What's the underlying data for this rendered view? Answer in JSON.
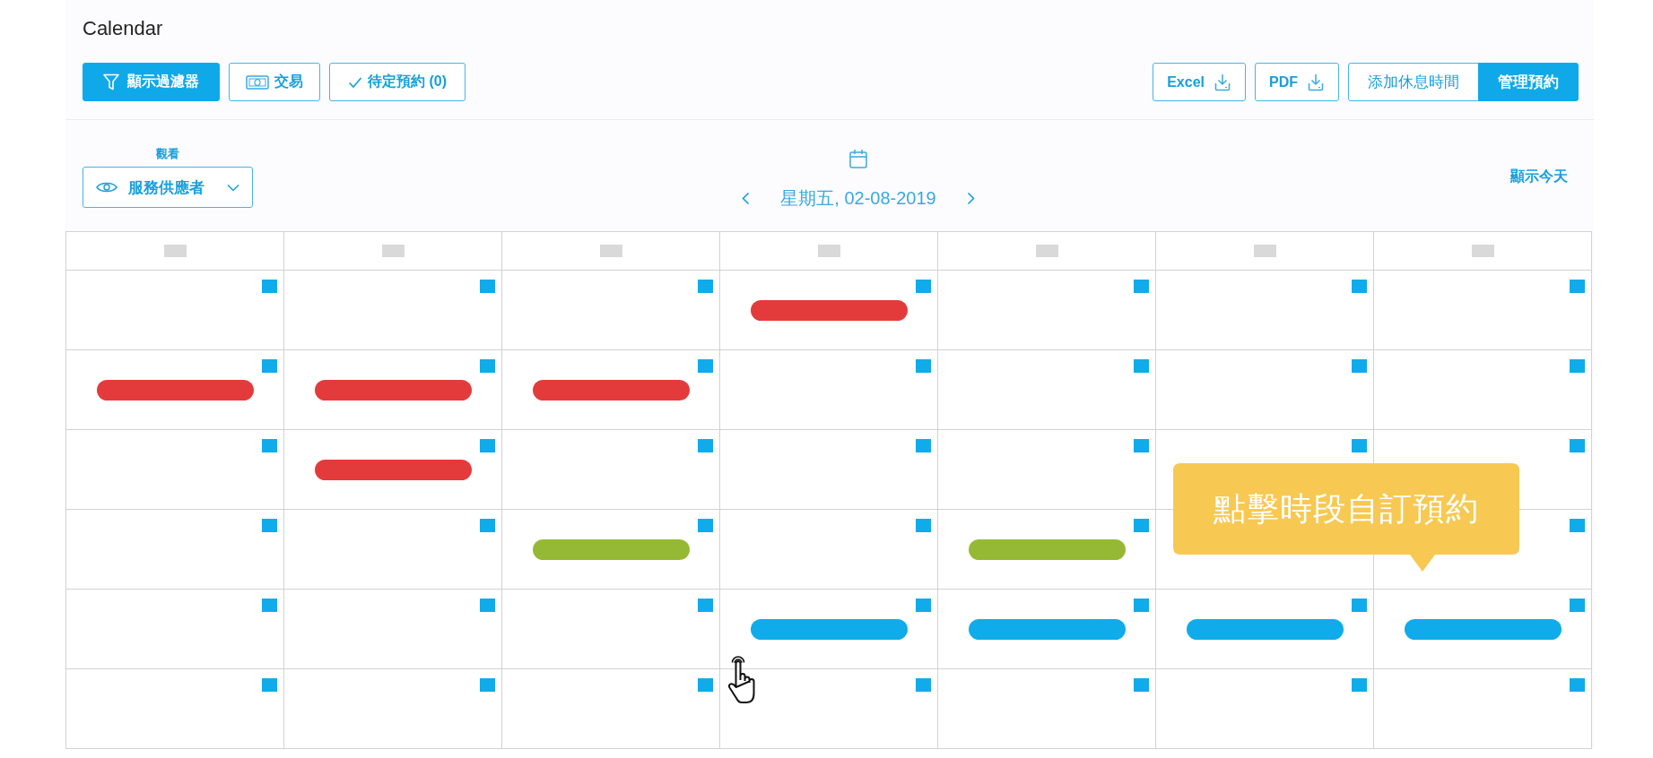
{
  "page": {
    "title": "Calendar"
  },
  "toolbar": {
    "left_buttons": [
      {
        "kind": "filter",
        "label": "顯示過濾器",
        "active": true
      },
      {
        "kind": "money",
        "label": "交易",
        "active": false
      },
      {
        "kind": "check",
        "label": "待定預約 (0)",
        "active": false
      }
    ],
    "export_buttons": [
      "Excel",
      "PDF"
    ],
    "mode_tabs": [
      {
        "label": "添加休息時間",
        "selected": false
      },
      {
        "label": "管理預約",
        "selected": true
      }
    ]
  },
  "view": {
    "label": "觀看",
    "value": "服務供應者"
  },
  "date_nav": {
    "date": "星期五, 02-08-2019"
  },
  "today_link": "顯示今天",
  "calendar": {
    "rows": [
      {
        "cells": [
          {
            "booked": false
          },
          {
            "booked": false
          },
          {
            "booked": false
          },
          {
            "booked": true,
            "color": "#e33b3b"
          },
          {
            "booked": false
          },
          {
            "booked": false
          },
          {
            "booked": false
          }
        ]
      },
      {
        "cells": [
          {
            "booked": true,
            "color": "#e33b3b"
          },
          {
            "booked": true,
            "color": "#e33b3b"
          },
          {
            "booked": true,
            "color": "#e33b3b"
          },
          {
            "booked": false
          },
          {
            "booked": false
          },
          {
            "booked": false
          },
          {
            "booked": false
          }
        ]
      },
      {
        "cells": [
          {
            "booked": false
          },
          {
            "booked": true,
            "color": "#e33b3b"
          },
          {
            "booked": false
          },
          {
            "booked": false
          },
          {
            "booked": false
          },
          {
            "booked": false
          },
          {
            "booked": false
          }
        ]
      },
      {
        "cells": [
          {
            "booked": false
          },
          {
            "booked": false
          },
          {
            "booked": true,
            "color": "#95b935"
          },
          {
            "booked": false
          },
          {
            "booked": true,
            "color": "#95b935"
          },
          {
            "booked": false
          },
          {
            "booked": false
          }
        ]
      },
      {
        "cells": [
          {
            "booked": false
          },
          {
            "booked": false
          },
          {
            "booked": false
          },
          {
            "booked": true,
            "color": "#10abeb"
          },
          {
            "booked": true,
            "color": "#10abeb"
          },
          {
            "booked": true,
            "color": "#10abeb"
          },
          {
            "booked": true,
            "color": "#10abeb"
          }
        ]
      },
      {
        "cells": [
          {
            "booked": false
          },
          {
            "booked": false
          },
          {
            "booked": false
          },
          {
            "booked": false
          },
          {
            "booked": false
          },
          {
            "booked": false
          },
          {
            "booked": false
          }
        ]
      }
    ]
  },
  "tooltip": {
    "text": "點擊時段自訂預約"
  }
}
